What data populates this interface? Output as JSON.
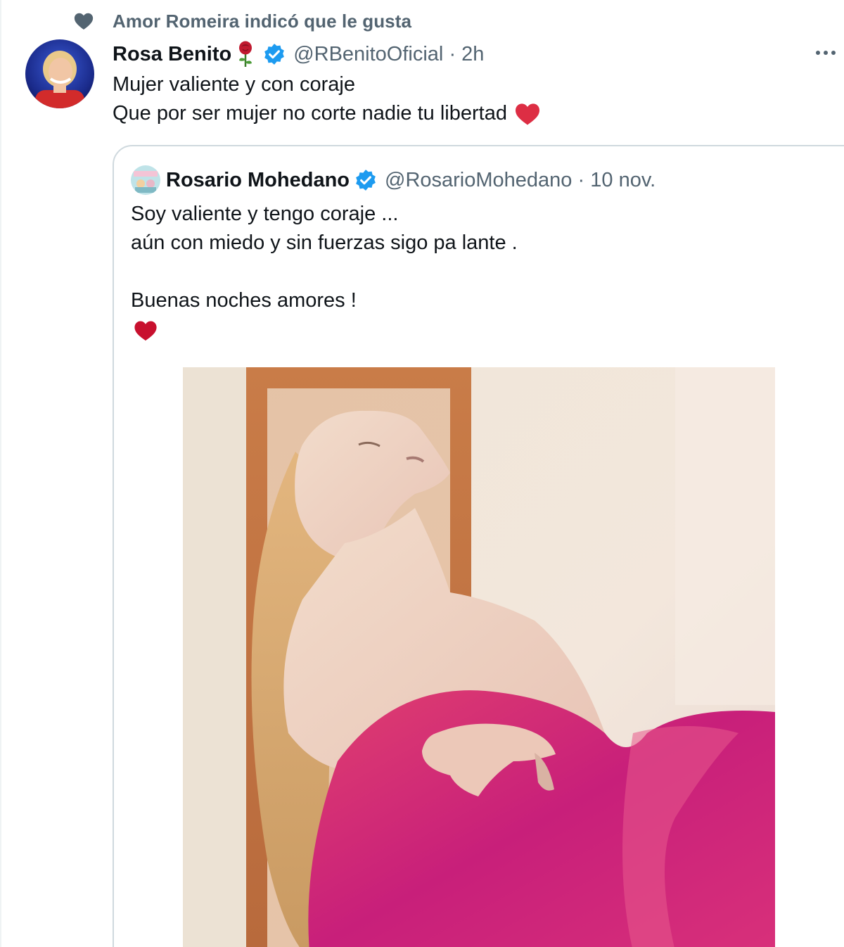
{
  "social_context": {
    "icon": "heart-icon",
    "text": "Amor Romeira indicó que le gusta"
  },
  "tweet": {
    "display_name": "Rosa Benito",
    "name_emoji": "rose-emoji",
    "verified": true,
    "handle": "@RBenitoOficial",
    "separator": "·",
    "time": "2h",
    "text_lines": [
      "Mujer valiente y con coraje",
      "Que por ser mujer no corte nadie tu libertad"
    ],
    "text_emoji": "red-heart-emoji",
    "more_icon": "more-icon"
  },
  "quoted_tweet": {
    "display_name": "Rosario Mohedano",
    "verified": true,
    "handle": "@RosarioMohedano",
    "separator": "·",
    "time": "10 nov.",
    "text_lines": [
      "Soy valiente y tengo coraje ...",
      "aún con miedo y sin fuerzas sigo pa lante .",
      "",
      "Buenas noches amores !"
    ],
    "trailing_emoji": "red-heart-emoji",
    "media": "photo"
  },
  "colors": {
    "text_primary": "#0f1419",
    "text_secondary": "#536471",
    "verified_blue": "#1d9bf0",
    "heart_red": "#e0245e",
    "border": "#cfd9de"
  }
}
